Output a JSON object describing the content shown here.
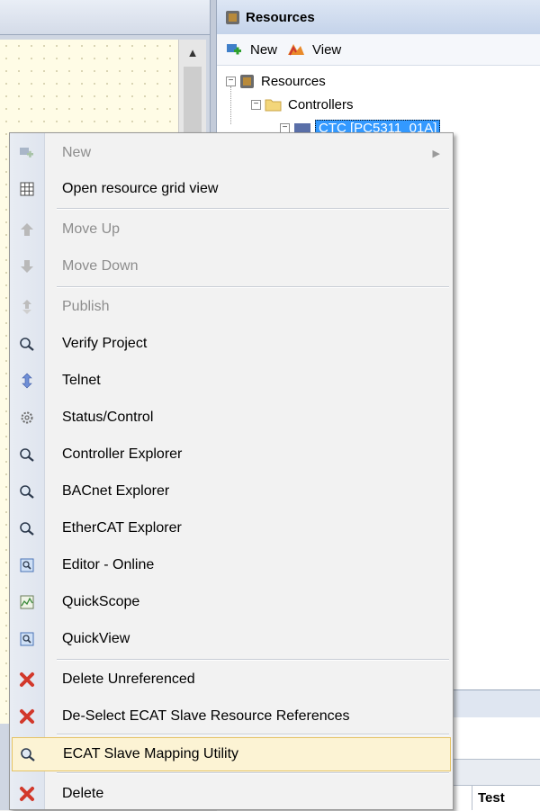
{
  "resources_panel": {
    "title": "Resources",
    "toolbar": {
      "new_label": "New",
      "view_label": "View"
    },
    "tree": {
      "root_label": "Resources",
      "controllers_label": "Controllers",
      "selected_label": "CTC [PC5311_01A]"
    }
  },
  "bottom_grid": {
    "column_header": "Test"
  },
  "context_menu": {
    "items": [
      {
        "label": "New",
        "icon": "new-icon",
        "enabled": false,
        "submenu": true
      },
      {
        "label": "Open resource grid view",
        "icon": "grid-icon",
        "enabled": true
      },
      {
        "label": "Move Up",
        "icon": "arrow-up-icon",
        "enabled": false
      },
      {
        "label": "Move Down",
        "icon": "arrow-down-icon",
        "enabled": false
      },
      {
        "label": "Publish",
        "icon": "publish-icon",
        "enabled": false
      },
      {
        "label": "Verify Project",
        "icon": "magnifier-icon",
        "enabled": true
      },
      {
        "label": "Telnet",
        "icon": "telnet-icon",
        "enabled": true
      },
      {
        "label": "Status/Control",
        "icon": "gear-icon",
        "enabled": true
      },
      {
        "label": "Controller Explorer",
        "icon": "magnifier-icon",
        "enabled": true
      },
      {
        "label": "BACnet Explorer",
        "icon": "magnifier-icon",
        "enabled": true
      },
      {
        "label": "EtherCAT Explorer",
        "icon": "magnifier-icon",
        "enabled": true
      },
      {
        "label": "Editor - Online",
        "icon": "editor-online-icon",
        "enabled": true
      },
      {
        "label": "QuickScope",
        "icon": "scope-icon",
        "enabled": true
      },
      {
        "label": "QuickView",
        "icon": "quickview-icon",
        "enabled": true
      },
      {
        "label": "Delete Unreferenced",
        "icon": "red-x-icon",
        "enabled": true
      },
      {
        "label": "De-Select ECAT Slave Resource References",
        "icon": "red-x-icon",
        "enabled": true
      },
      {
        "label": "ECAT Slave Mapping Utility",
        "icon": "magnifier-icon",
        "enabled": true,
        "highlighted": true
      },
      {
        "label": "Delete",
        "icon": "red-x-icon",
        "enabled": true
      }
    ]
  }
}
